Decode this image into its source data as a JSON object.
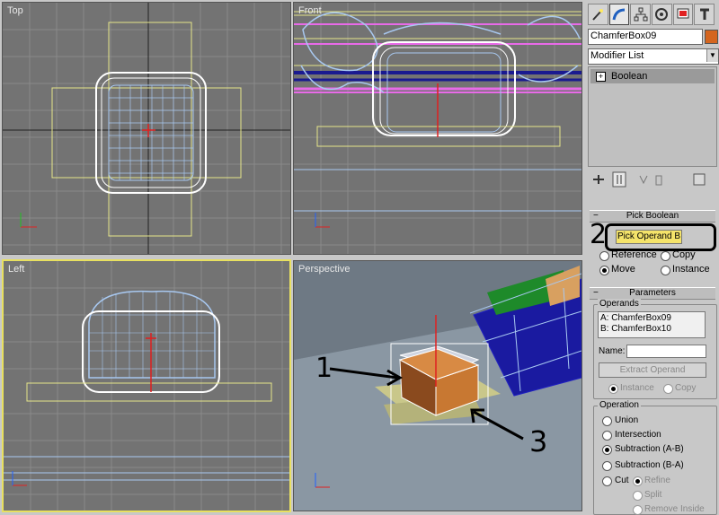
{
  "viewports": {
    "top": {
      "label": "Top"
    },
    "front": {
      "label": "Front"
    },
    "left": {
      "label": "Left"
    },
    "perspective": {
      "label": "Perspective"
    }
  },
  "annotations": {
    "one": "1",
    "two": "2",
    "three": "3"
  },
  "panel": {
    "tabs": [
      "create-icon",
      "modify-icon",
      "hierarchy-icon",
      "motion-icon",
      "display-icon",
      "utilities-icon"
    ],
    "object_name": "ChamferBox09",
    "object_color": "#d4651f",
    "modifier_list": "Modifier List",
    "stack_item": "Boolean",
    "pick_boolean": {
      "title": "Pick Boolean",
      "button": "Pick Operand B",
      "reference": "Reference",
      "copy": "Copy",
      "move": "Move",
      "instance": "Instance"
    },
    "parameters": {
      "title": "Parameters",
      "operands_title": "Operands",
      "operand_a": "A: ChamferBox09",
      "operand_b": "B: ChamferBox10",
      "name_label": "Name:",
      "name_value": "",
      "extract_button": "Extract Operand",
      "instance": "Instance",
      "copy": "Copy",
      "operation_title": "Operation",
      "union": "Union",
      "intersection": "Intersection",
      "subtraction_ab": "Subtraction (A-B)",
      "subtraction_ba": "Subtraction (B-A)",
      "cut": "Cut",
      "refine": "Refine",
      "split": "Split",
      "remove_inside": "Remove Inside"
    }
  }
}
